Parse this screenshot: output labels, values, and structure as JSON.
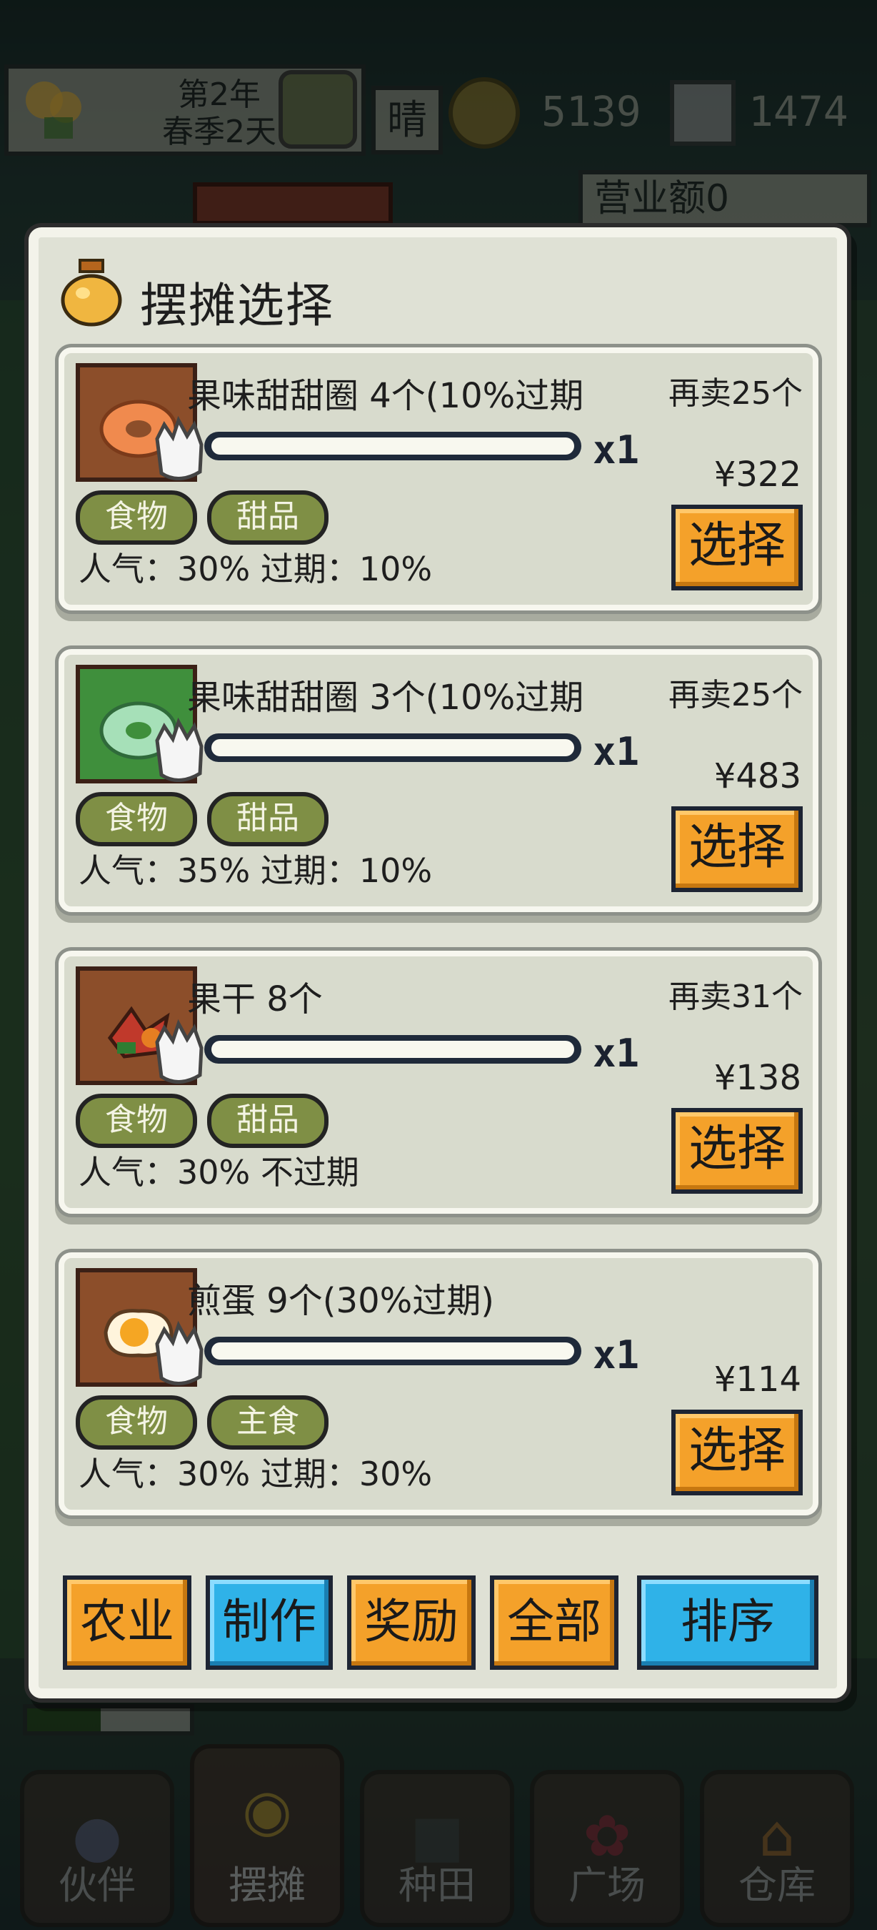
{
  "hud": {
    "year": "第2年",
    "season_day": "春季2天",
    "weather": "晴",
    "money": "5139",
    "gems": "1474",
    "revenue": "营业额0",
    "progress": 0.45
  },
  "dialog": {
    "title": "摆摊选择",
    "items": [
      {
        "name": "果味甜甜圈 4个(10%过期",
        "resell": "再卖25个",
        "qty": "x1",
        "price": "¥322",
        "tags": [
          "食物",
          "甜品"
        ],
        "stats": "人气：30%  过期：10%",
        "select": "选择"
      },
      {
        "name": "果味甜甜圈 3个(10%过期",
        "resell": "再卖25个",
        "qty": "x1",
        "price": "¥483",
        "tags": [
          "食物",
          "甜品"
        ],
        "stats": "人气：35%  过期：10%",
        "select": "选择"
      },
      {
        "name": "果干 8个",
        "resell": "再卖31个",
        "qty": "x1",
        "price": "¥138",
        "tags": [
          "食物",
          "甜品"
        ],
        "stats": "人气：30%  不过期",
        "select": "选择"
      },
      {
        "name": "煎蛋 9个(30%过期)",
        "resell": "",
        "qty": "x1",
        "price": "¥114",
        "tags": [
          "食物",
          "主食"
        ],
        "stats": "人气：30%  过期：30%",
        "select": "选择"
      }
    ],
    "filters": {
      "agriculture": "农业",
      "crafting": "制作",
      "reward": "奖励",
      "all": "全部",
      "sort": "排序"
    }
  },
  "nav": {
    "partner": "伙伴",
    "stall": "摆摊",
    "farm": "种田",
    "plaza": "广场",
    "warehouse": "仓库"
  },
  "colors": {
    "button_orange": "#f4a12a",
    "button_blue": "#2fb2e8",
    "tag_green": "#7f8f45",
    "panel": "#dfe1d5"
  }
}
